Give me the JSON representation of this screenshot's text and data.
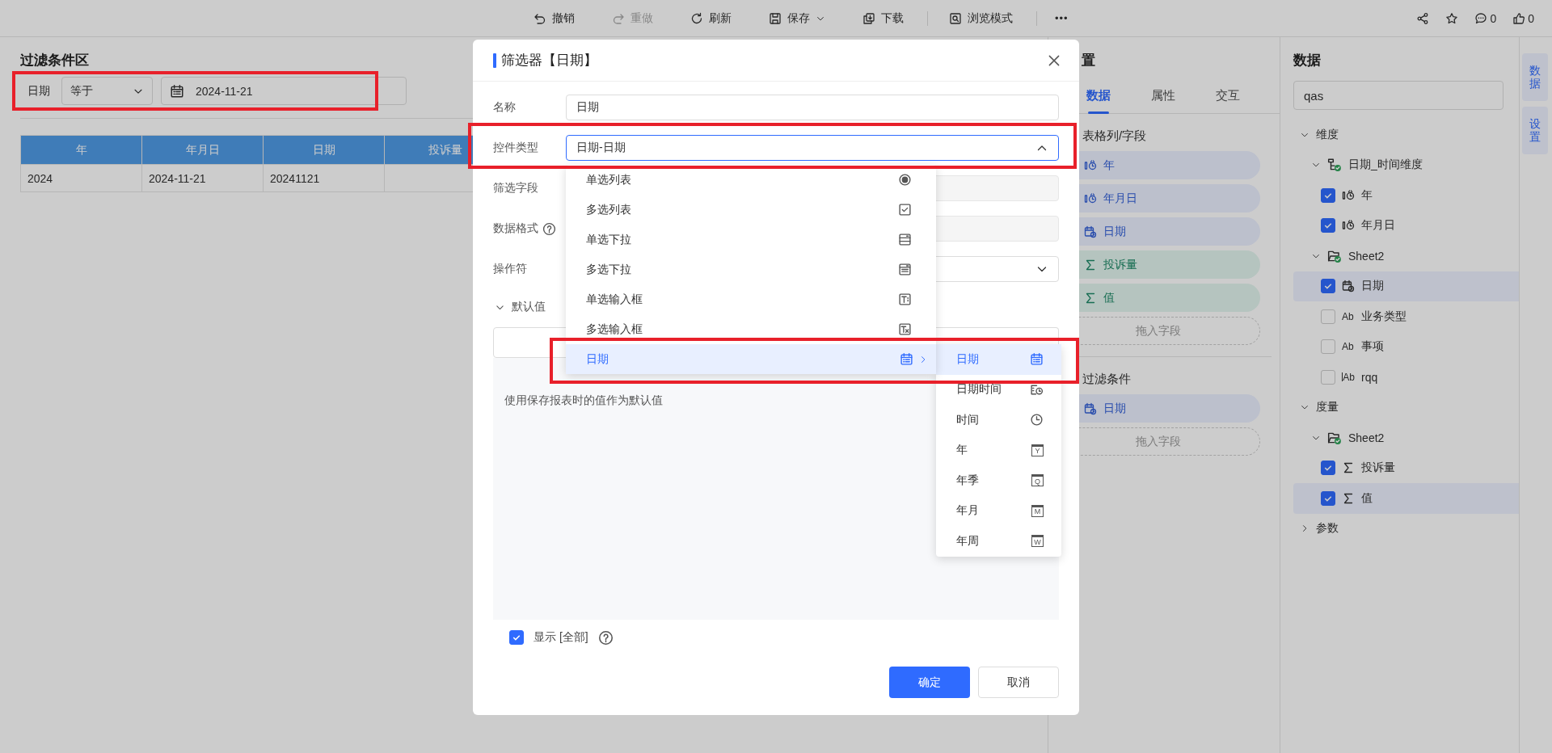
{
  "toolbar": {
    "actions": [
      {
        "kind": "undo",
        "label": "撤销",
        "disabled": false,
        "caret": false,
        "divider_after": false
      },
      {
        "kind": "redo",
        "label": "重做",
        "disabled": true,
        "caret": false,
        "divider_after": false
      },
      {
        "kind": "refresh",
        "label": "刷新",
        "disabled": false,
        "caret": false,
        "divider_after": false
      },
      {
        "kind": "save",
        "label": "保存",
        "disabled": false,
        "caret": true,
        "divider_after": false
      },
      {
        "kind": "download",
        "label": "下载",
        "disabled": false,
        "caret": false,
        "divider_after": true
      },
      {
        "kind": "browse",
        "label": "浏览模式",
        "disabled": false,
        "caret": false,
        "divider_after": true
      }
    ],
    "more": "•••",
    "social": [
      {
        "kind": "share"
      },
      {
        "kind": "star"
      },
      {
        "kind": "comment",
        "count": "0"
      },
      {
        "kind": "like",
        "count": "0"
      }
    ]
  },
  "filter_area": {
    "title": "过滤条件区",
    "highlighted": true,
    "label": "日期",
    "operator": "等于",
    "date": "2024-11-21"
  },
  "table": {
    "columns": [
      "年",
      "年月日",
      "日期",
      "投诉量"
    ],
    "rows": [
      [
        "2024",
        "2024-11-21",
        "20241121"
      ]
    ]
  },
  "config_panel": {
    "title": "置",
    "tabs": [
      {
        "label": "数据",
        "selected": true
      },
      {
        "label": "属性",
        "selected": false
      },
      {
        "label": "交互",
        "selected": false
      }
    ],
    "sections": [
      {
        "title": "表格列/字段",
        "fields": [
          {
            "kind": "time",
            "label": "年"
          },
          {
            "kind": "time",
            "label": "年月日"
          },
          {
            "kind": "date",
            "label": "日期"
          },
          {
            "kind": "measure",
            "label": "投诉量"
          },
          {
            "kind": "measure",
            "label": "值"
          }
        ],
        "drop_hint": "拖入字段"
      },
      {
        "title": "过滤条件",
        "fields": [
          {
            "kind": "date",
            "label": "日期"
          }
        ],
        "drop_hint": "拖入字段"
      }
    ]
  },
  "data_panel": {
    "title": "数据",
    "search": {
      "value": "qas"
    },
    "tree": [
      {
        "kind": "group",
        "label": "维度",
        "expanded": true,
        "children": [
          {
            "kind": "hierarchy",
            "label": "日期_时间维度",
            "expanded": true,
            "children": [
              {
                "kind": "time",
                "label": "年",
                "checked": true,
                "selected": false
              },
              {
                "kind": "time",
                "label": "年月日",
                "checked": true,
                "selected": false
              }
            ]
          },
          {
            "kind": "table",
            "label": "Sheet2",
            "expanded": true,
            "children": [
              {
                "kind": "date",
                "label": "日期",
                "checked": true,
                "selected": true
              },
              {
                "kind": "text",
                "icon_text": "Ab",
                "label": "业务类型",
                "checked": false,
                "selected": false
              },
              {
                "kind": "text",
                "icon_text": "Ab",
                "label": "事项",
                "checked": false,
                "selected": false
              },
              {
                "kind": "coded-text",
                "icon_text": "Ab",
                "label": "rqq",
                "checked": false,
                "selected": false
              }
            ]
          }
        ]
      },
      {
        "kind": "group",
        "label": "度量",
        "expanded": true,
        "children": [
          {
            "kind": "table",
            "label": "Sheet2",
            "expanded": true,
            "children": [
              {
                "kind": "measure",
                "label": "投诉量",
                "checked": true,
                "selected": false
              },
              {
                "kind": "measure",
                "label": "值",
                "checked": true,
                "selected": true
              }
            ]
          }
        ]
      },
      {
        "kind": "group",
        "label": "参数",
        "expanded": false
      }
    ]
  },
  "side_tabs": [
    {
      "label": "数据"
    },
    {
      "label": "设置"
    }
  ],
  "dialog": {
    "title": "筛选器【日期】",
    "fields": [
      {
        "kind": "input",
        "label": "名称",
        "value": "日期"
      },
      {
        "kind": "select",
        "label": "控件类型",
        "value": "日期-日期",
        "open": true,
        "highlighted": true
      },
      {
        "kind": "readonly",
        "label": "筛选字段"
      },
      {
        "kind": "readonly",
        "label": "数据格式",
        "help": true
      },
      {
        "kind": "select",
        "label": "操作符",
        "open": false
      }
    ],
    "dropdown": [
      {
        "kind": "radio",
        "label": "单选列表",
        "selected": false
      },
      {
        "kind": "checkbox",
        "label": "多选列表",
        "selected": false
      },
      {
        "kind": "single-select",
        "label": "单选下拉",
        "selected": false
      },
      {
        "kind": "multi-select",
        "label": "多选下拉",
        "selected": false
      },
      {
        "kind": "single-input",
        "label": "单选输入框",
        "selected": false
      },
      {
        "kind": "multi-input",
        "label": "多选输入框",
        "selected": false
      },
      {
        "kind": "calendar",
        "label": "日期",
        "selected": true,
        "has_submenu": true,
        "highlighted": true
      }
    ],
    "submenu": [
      {
        "kind": "calendar",
        "label": "日期",
        "selected": true
      },
      {
        "kind": "datetime",
        "label": "日期时间",
        "selected": false
      },
      {
        "kind": "clock",
        "label": "时间",
        "selected": false
      },
      {
        "kind": "letter",
        "icon_letter": "Y",
        "label": "年",
        "selected": false
      },
      {
        "kind": "letter",
        "icon_letter": "Q",
        "label": "年季",
        "selected": false
      },
      {
        "kind": "letter",
        "icon_letter": "M",
        "label": "年月",
        "selected": false
      },
      {
        "kind": "letter",
        "icon_letter": "W",
        "label": "年周",
        "selected": false
      }
    ],
    "default_value": {
      "label": "默认值",
      "expanded": true,
      "note": "使用保存报表时的值作为默认值"
    },
    "show_all": {
      "label": "显示 [全部]",
      "checked": true,
      "help": true
    },
    "buttons": [
      {
        "kind": "primary",
        "label": "确定"
      },
      {
        "kind": "default",
        "label": "取消"
      }
    ]
  }
}
